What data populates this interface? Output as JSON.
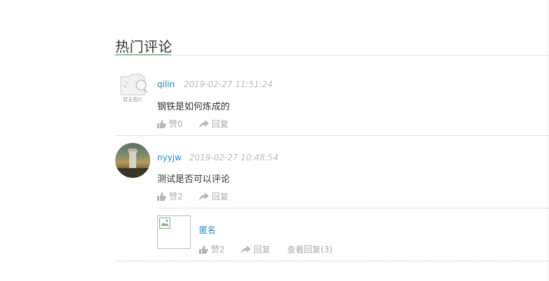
{
  "section": {
    "title": "热门评论"
  },
  "placeholder_avatar": {
    "caption": "暂无图片"
  },
  "comments": [
    {
      "username": "qilin",
      "time": "2019-02-27 11:51:24",
      "content": "钢铁是如何炼成的",
      "like_label": "赞0",
      "reply_label": "回复",
      "avatar": "no-image-placeholder"
    },
    {
      "username": "nyyjw",
      "time": "2019-02-27 10:48:54",
      "content": "测试是否可以评论",
      "like_label": "赞2",
      "reply_label": "回复",
      "avatar": "photo",
      "replies": [
        {
          "username": "匿名",
          "like_label": "赞2",
          "reply_label": "回复",
          "view_replies_label": "查看回复(3)"
        }
      ]
    }
  ],
  "colors": {
    "accent": "#3aa36a",
    "username": "#1e88c8",
    "muted": "#aaaaaa"
  }
}
